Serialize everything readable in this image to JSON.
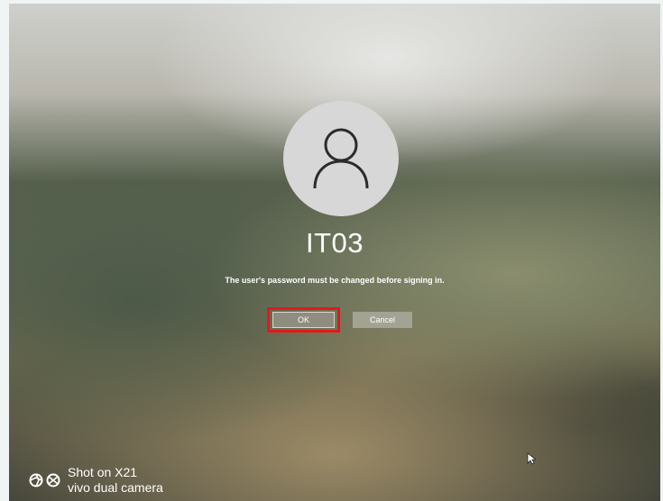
{
  "login": {
    "username": "IT03",
    "message": "The user's password must be changed before signing in.",
    "ok_label": "OK",
    "cancel_label": "Cancel"
  },
  "watermark": {
    "line1": "Shot on X21",
    "line2": "vivo dual camera"
  },
  "icons": {
    "avatar": "user-icon",
    "cursor": "mouse-pointer-icon",
    "watermark": "camera-lens-icon"
  },
  "colors": {
    "highlight": "#e8161a",
    "button": "#8e8d80"
  }
}
